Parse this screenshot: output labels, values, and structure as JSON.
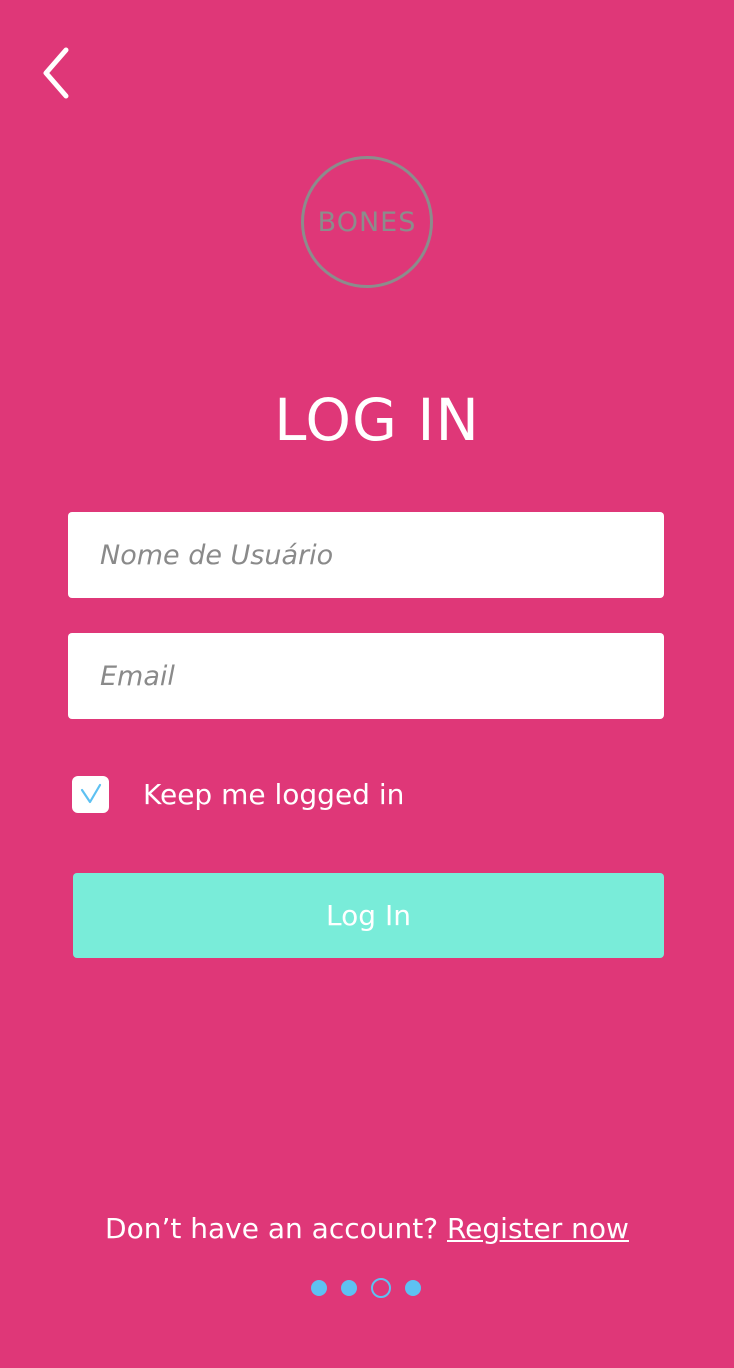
{
  "header": {
    "back_icon": "chevron-left-icon"
  },
  "logo": {
    "text": "BONES"
  },
  "title": "LOG IN",
  "form": {
    "username_placeholder": "Nome de Usuário",
    "username_value": "",
    "email_placeholder": "Email",
    "email_value": "",
    "keep_logged_in_label": "Keep me logged in",
    "keep_logged_in_checked": true,
    "submit_label": "Log In"
  },
  "footer": {
    "prompt": "Don’t have an account?",
    "register_link": "Register now"
  },
  "pagination": {
    "total": 4,
    "active_index": 2
  },
  "colors": {
    "background": "#df3778",
    "button": "#79ecd9",
    "accent_blue": "#5ec1f2",
    "logo_gray": "#8c8c8c"
  }
}
